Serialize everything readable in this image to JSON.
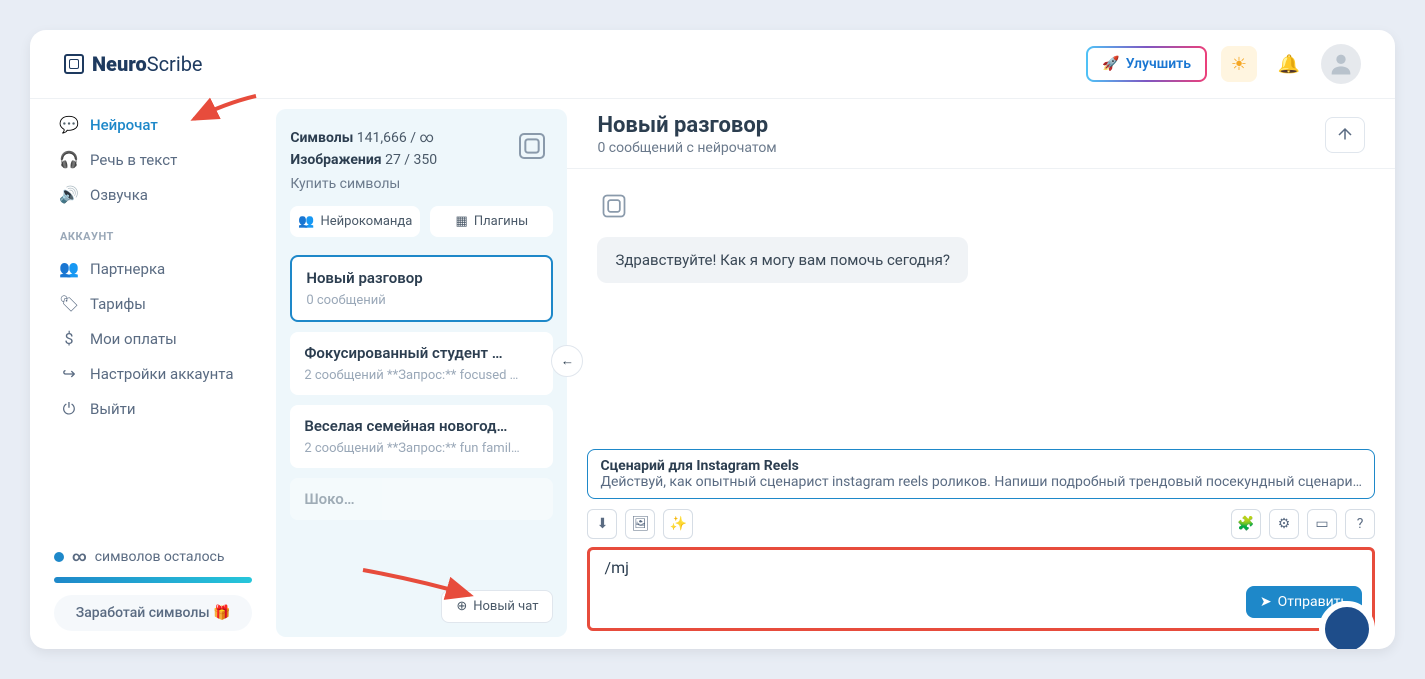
{
  "header": {
    "logo_brand": "Neuro",
    "logo_suffix": "Scribe",
    "upgrade_label": "Улучшить"
  },
  "sidebar": {
    "items": [
      {
        "icon": "chat-icon",
        "label": "Нейрочат",
        "active": true
      },
      {
        "icon": "headphones-icon",
        "label": "Речь в текст"
      },
      {
        "icon": "speaker-icon",
        "label": "Озвучка"
      }
    ],
    "account_section_label": "АККАУНТ",
    "account_items": [
      {
        "icon": "users-icon",
        "label": "Партнерка"
      },
      {
        "icon": "tag-icon",
        "label": "Тарифы"
      },
      {
        "icon": "dollar-icon",
        "label": "Мои оплаты"
      },
      {
        "icon": "settings-icon",
        "label": "Настройки аккаунта"
      },
      {
        "icon": "power-icon",
        "label": "Выйти"
      }
    ],
    "symbols_left_label": "символов осталось",
    "infinity": "∞",
    "earn_label": "Заработай символы 🎁"
  },
  "chatlist": {
    "symbols_label": "Символы",
    "symbols_value": "141,666 / ∞",
    "images_label": "Изображения",
    "images_value": "27 / 350",
    "buy_label": "Купить символы",
    "team_chip": "Нейрокоманда",
    "plugins_chip": "Плагины",
    "conversations": [
      {
        "title": "Новый разговор",
        "sub": "0 сообщений",
        "active": true
      },
      {
        "title": "Фокусированный студент …",
        "sub": "2 сообщений   **Запрос:** focused …"
      },
      {
        "title": "Веселая семейная новогод…",
        "sub": "2 сообщений   **Запрос:** fun famil…"
      },
      {
        "title": "Шоко…",
        "sub": ""
      }
    ],
    "new_chat_label": "Новый чат"
  },
  "chat": {
    "title": "Новый разговор",
    "subtitle": "0 сообщений с нейрочатом",
    "greeting": "Здравствуйте! Как я могу вам помочь сегодня?",
    "prompt_title": "Сценарий для Instagram Reels",
    "prompt_body": "Действуй, как опытный сценарист instagram reels роликов. Напиши подробный трендовый посекундный сценари…",
    "input_value": "/mj",
    "send_label": "Отправить"
  }
}
